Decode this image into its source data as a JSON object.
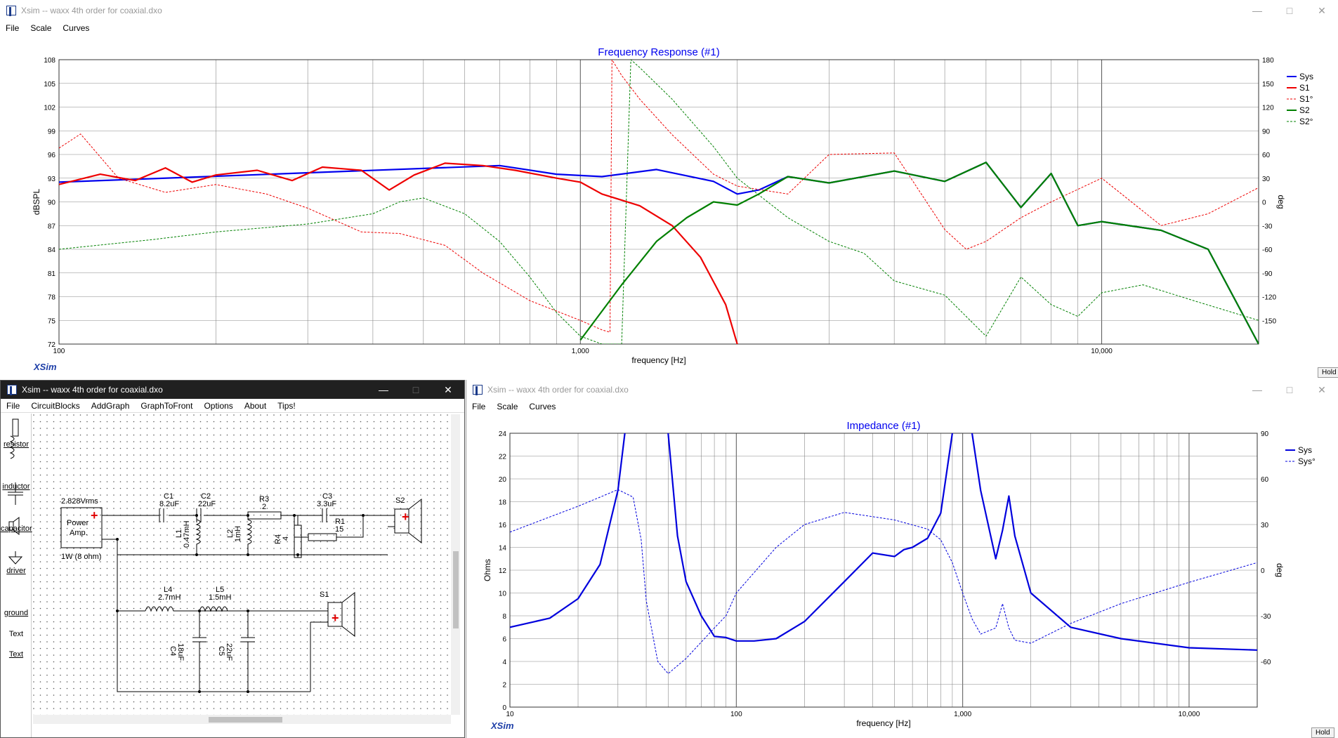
{
  "window_title": "Xsim -- waxx 4th order for coaxial.dxo",
  "freq_window": {
    "menu": [
      "File",
      "Scale",
      "Curves"
    ],
    "hold": "Hold",
    "brand": "XSim"
  },
  "imp_window": {
    "menu": [
      "File",
      "Scale",
      "Curves"
    ],
    "hold": "Hold",
    "brand": "XSim"
  },
  "circuit_window": {
    "menu": [
      "File",
      "CircuitBlocks",
      "AddGraph",
      "GraphToFront",
      "Options",
      "About",
      "Tips!"
    ],
    "palette": [
      "resistor",
      "inductor",
      "capacitor",
      "driver",
      "ground",
      "Text",
      "Text"
    ],
    "source": {
      "voltage": "2.828Vrms",
      "label1": "Power",
      "label2": "Amp.",
      "power": "1W (8 ohm)"
    },
    "components": [
      {
        "name": "C1",
        "value": "8.2uF"
      },
      {
        "name": "C2",
        "value": "22uF"
      },
      {
        "name": "R3",
        "value": "2"
      },
      {
        "name": "C3",
        "value": "3.3uF"
      },
      {
        "name": "R1",
        "value": "15"
      },
      {
        "name": "L1",
        "value": "0.47mH"
      },
      {
        "name": "L2",
        "value": "1mH"
      },
      {
        "name": "R4",
        "value": "4"
      },
      {
        "name": "L4",
        "value": "2.7mH"
      },
      {
        "name": "L5",
        "value": "1.5mH"
      },
      {
        "name": "C4",
        "value": "18uF"
      },
      {
        "name": "C5",
        "value": "22uF"
      }
    ],
    "drivers": [
      "S2",
      "S1"
    ]
  },
  "chart_data": [
    {
      "type": "line",
      "title": "Frequency Response (#1)",
      "xlabel": "frequency [Hz]",
      "ylabel": "dBSPL",
      "y2label": "deg",
      "xscale": "log",
      "xlim": [
        100,
        20000
      ],
      "ylim": [
        72,
        108
      ],
      "y2lim": [
        -180,
        180
      ],
      "xticks": [
        "100",
        "1,000",
        "10,000"
      ],
      "yticks": [
        "108",
        "105",
        "102",
        "99",
        "96",
        "93",
        "90",
        "87",
        "84",
        "81",
        "78",
        "75",
        "72"
      ],
      "y2ticks": [
        "180",
        "150",
        "120",
        "90",
        "60",
        "30",
        "0",
        "-30",
        "-60",
        "-90",
        "-120",
        "-150"
      ],
      "legend": "top-right",
      "grid": true,
      "series": [
        {
          "name": "Sys",
          "color": "#0000ee",
          "style": "solid",
          "axis": "left",
          "x": [
            100,
            700,
            900,
            1100,
            1400,
            1800,
            2000,
            2200,
            2500,
            3000,
            4000,
            5000,
            6000,
            7000,
            8000,
            9000,
            10000,
            13000,
            16000,
            20000
          ],
          "y": [
            92.5,
            94.6,
            93.5,
            93.2,
            94.1,
            92.6,
            91,
            91.5,
            93.2,
            92.4,
            93.9,
            92.6,
            95,
            89.3,
            93.6,
            87,
            87.5,
            86.4,
            84,
            72
          ]
        },
        {
          "name": "S1",
          "color": "#ee0000",
          "style": "solid",
          "axis": "left",
          "x": [
            100,
            120,
            140,
            160,
            180,
            200,
            240,
            280,
            320,
            380,
            430,
            480,
            550,
            650,
            750,
            900,
            1000,
            1100,
            1300,
            1500,
            1700,
            1900,
            2000
          ],
          "y": [
            92.2,
            93.5,
            92.7,
            94.3,
            92.5,
            93.4,
            94,
            92.7,
            94.4,
            94,
            91.5,
            93.4,
            94.9,
            94.6,
            94,
            93,
            92.5,
            91,
            89.5,
            87,
            83,
            77,
            72
          ]
        },
        {
          "name": "S1°",
          "color": "#ee0000",
          "style": "dash",
          "axis": "right",
          "x": [
            100,
            110,
            130,
            160,
            200,
            250,
            300,
            380,
            450,
            550,
            650,
            800,
            1000,
            1100,
            1140,
            1150,
            1200,
            1300,
            1500,
            1800,
            2000,
            2500,
            3000,
            4000,
            5000,
            5500,
            6000,
            7000,
            8000,
            10000,
            13000,
            16000,
            20000
          ],
          "y": [
            68,
            86,
            30,
            12,
            22,
            10,
            -8,
            -38,
            -40,
            -55,
            -90,
            -125,
            -150,
            -162,
            -165,
            180,
            160,
            130,
            85,
            35,
            20,
            10,
            60,
            62,
            -35,
            -60,
            -50,
            -20,
            0,
            30,
            -30,
            -15,
            18
          ]
        },
        {
          "name": "S2",
          "color": "#008000",
          "style": "solid",
          "axis": "left",
          "x": [
            1000,
            1200,
            1400,
            1600,
            1800,
            2000,
            2200,
            2500,
            3000,
            4000,
            5000,
            6000,
            7000,
            8000,
            9000,
            10000,
            13000,
            16000,
            20000
          ],
          "y": [
            72.5,
            79.5,
            85,
            88,
            90,
            89.6,
            91,
            93.2,
            92.4,
            93.9,
            92.6,
            95,
            89.3,
            93.6,
            87,
            87.5,
            86.4,
            84,
            72
          ]
        },
        {
          "name": "S2°",
          "color": "#008000",
          "style": "dash",
          "axis": "right",
          "x": [
            100,
            150,
            200,
            300,
            400,
            450,
            500,
            600,
            700,
            800,
            900,
            1000,
            1100,
            1200,
            1250,
            1300,
            1500,
            1800,
            2000,
            2500,
            3000,
            3500,
            4000,
            5000,
            6000,
            7000,
            8000,
            9000,
            10000,
            12000,
            15000,
            20000
          ],
          "y": [
            -60,
            -48,
            -38,
            -28,
            -15,
            0,
            5,
            -15,
            -50,
            -95,
            -140,
            -170,
            -180,
            -180,
            180,
            170,
            130,
            70,
            30,
            -20,
            -50,
            -65,
            -100,
            -118,
            -170,
            -95,
            -130,
            -145,
            -115,
            -105,
            -125,
            -150
          ]
        }
      ]
    },
    {
      "type": "line",
      "title": "Impedance (#1)",
      "xlabel": "frequency [Hz]",
      "ylabel": "Ohms",
      "y2label": "deg",
      "xscale": "log",
      "xlim": [
        10,
        20000
      ],
      "ylim": [
        0,
        24
      ],
      "y2lim": [
        -90,
        90
      ],
      "xticks": [
        "10",
        "100",
        "1,000",
        "10,000"
      ],
      "yticks": [
        "24",
        "22",
        "20",
        "18",
        "16",
        "14",
        "12",
        "10",
        "8",
        "6",
        "4",
        "2",
        "0"
      ],
      "y2ticks": [
        "90",
        "60",
        "30",
        "0",
        "-30",
        "-60"
      ],
      "legend": "top-right",
      "grid": true,
      "series": [
        {
          "name": "Sys",
          "color": "#0000dd",
          "style": "solid",
          "axis": "left",
          "x": [
            10,
            15,
            20,
            25,
            30,
            35,
            40,
            45,
            50,
            55,
            60,
            70,
            80,
            90,
            100,
            120,
            150,
            200,
            300,
            400,
            500,
            550,
            600,
            700,
            800,
            900,
            1000,
            1100,
            1200,
            1400,
            1500,
            1600,
            1700,
            2000,
            3000,
            5000,
            10000,
            20000
          ],
          "y": [
            7,
            7.8,
            9.5,
            12.5,
            19,
            30,
            30,
            30,
            24,
            15,
            11,
            8,
            6.2,
            6.1,
            5.8,
            5.8,
            6,
            7.5,
            11,
            13.5,
            13.2,
            13.8,
            14,
            14.8,
            17,
            24,
            26,
            24,
            19,
            13,
            15.5,
            18.5,
            15,
            10,
            7,
            6,
            5.2,
            5
          ]
        },
        {
          "name": "Sys°",
          "color": "#0000dd",
          "style": "dash",
          "axis": "right",
          "x": [
            10,
            15,
            20,
            25,
            30,
            35,
            38,
            40,
            45,
            50,
            60,
            80,
            90,
            100,
            150,
            200,
            300,
            500,
            700,
            800,
            900,
            1000,
            1100,
            1200,
            1400,
            1500,
            1600,
            1700,
            2000,
            3000,
            5000,
            10000,
            20000
          ],
          "y": [
            25,
            35,
            42,
            48,
            53,
            48,
            20,
            -20,
            -60,
            -68,
            -58,
            -38,
            -30,
            -15,
            15,
            30,
            38,
            33,
            27,
            20,
            5,
            -15,
            -32,
            -42,
            -38,
            -22,
            -38,
            -46,
            -48,
            -35,
            -22,
            -8,
            5
          ]
        }
      ]
    }
  ]
}
